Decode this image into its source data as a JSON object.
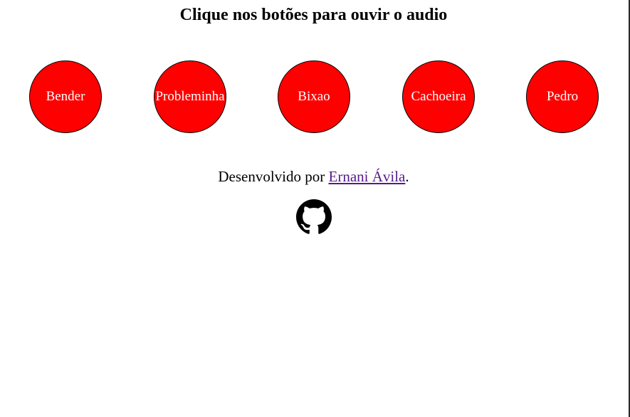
{
  "page": {
    "title": "Clique nos botões para ouvir o audio"
  },
  "buttons": [
    {
      "label": "Bender"
    },
    {
      "label": "Probleminha"
    },
    {
      "label": "Bixao"
    },
    {
      "label": "Cachoeira"
    },
    {
      "label": "Pedro"
    }
  ],
  "footer": {
    "text_before": "Desenvolvido por ",
    "author_link": "Ernani Ávila",
    "text_after": ".",
    "github_icon": "github-icon"
  },
  "colors": {
    "button_fill": "#ff0000",
    "button_text": "#ffffff",
    "link_visited": "#551a8b"
  }
}
